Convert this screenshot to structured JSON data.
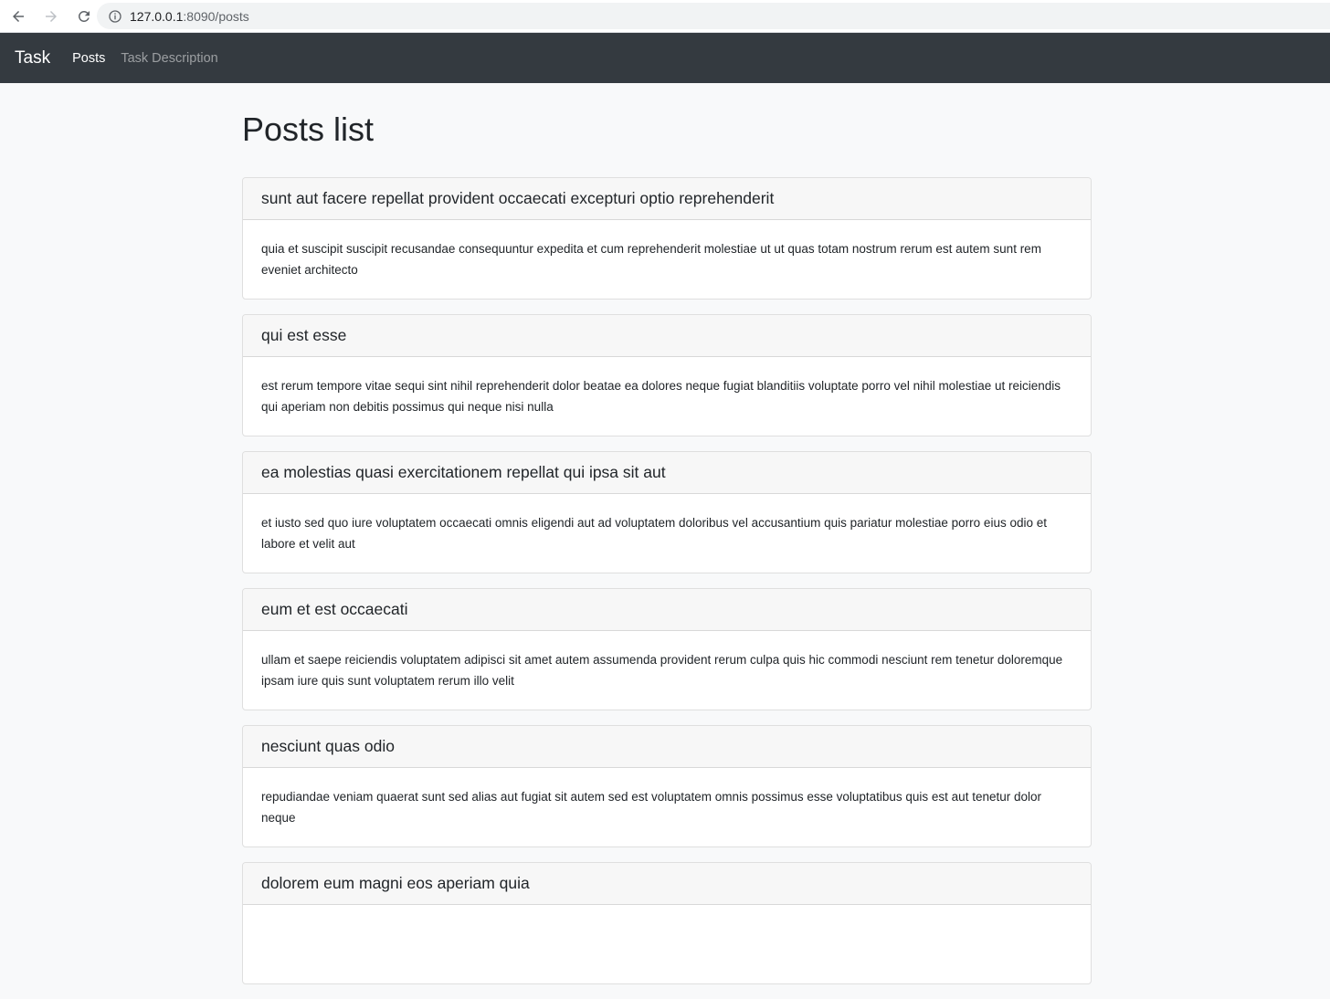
{
  "browser": {
    "url_host": "127.0.0.1",
    "url_path": ":8090/posts"
  },
  "navbar": {
    "brand": "Task",
    "links": [
      {
        "label": "Posts",
        "active": true
      },
      {
        "label": "Task Description",
        "active": false
      }
    ]
  },
  "page": {
    "title": "Posts list"
  },
  "posts": [
    {
      "title": "sunt aut facere repellat provident occaecati excepturi optio reprehenderit",
      "body": "quia et suscipit suscipit recusandae consequuntur expedita et cum reprehenderit molestiae ut ut quas totam nostrum rerum est autem sunt rem eveniet architecto"
    },
    {
      "title": "qui est esse",
      "body": "est rerum tempore vitae sequi sint nihil reprehenderit dolor beatae ea dolores neque fugiat blanditiis voluptate porro vel nihil molestiae ut reiciendis qui aperiam non debitis possimus qui neque nisi nulla"
    },
    {
      "title": "ea molestias quasi exercitationem repellat qui ipsa sit aut",
      "body": "et iusto sed quo iure voluptatem occaecati omnis eligendi aut ad voluptatem doloribus vel accusantium quis pariatur molestiae porro eius odio et labore et velit aut"
    },
    {
      "title": "eum et est occaecati",
      "body": "ullam et saepe reiciendis voluptatem adipisci sit amet autem assumenda provident rerum culpa quis hic commodi nesciunt rem tenetur doloremque ipsam iure quis sunt voluptatem rerum illo velit"
    },
    {
      "title": "nesciunt quas odio",
      "body": "repudiandae veniam quaerat sunt sed alias aut fugiat sit autem sed est voluptatem omnis possimus esse voluptatibus quis est aut tenetur dolor neque"
    },
    {
      "title": "dolorem eum magni eos aperiam quia",
      "body": ""
    }
  ]
}
